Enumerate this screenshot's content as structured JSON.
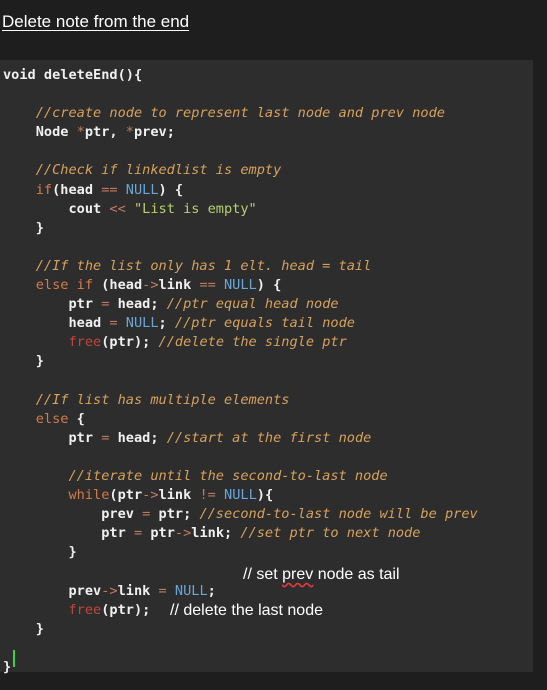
{
  "title": "Delete note from the end",
  "code_lines": [
    [
      {
        "t": "void deleteEnd(){",
        "c": "p"
      }
    ],
    [],
    [
      {
        "t": "    //create node to represent last node and prev node",
        "c": "c"
      }
    ],
    [
      {
        "t": "    Node ",
        "c": "p"
      },
      {
        "t": "*",
        "c": "o"
      },
      {
        "t": "ptr, ",
        "c": "p"
      },
      {
        "t": "*",
        "c": "o"
      },
      {
        "t": "prev;",
        "c": "p"
      }
    ],
    [],
    [
      {
        "t": "    //Check if linkedlist is empty",
        "c": "c"
      }
    ],
    [
      {
        "t": "    if",
        "c": "k"
      },
      {
        "t": "(head ",
        "c": "p"
      },
      {
        "t": "==",
        "c": "o"
      },
      {
        "t": " ",
        "c": "p"
      },
      {
        "t": "NULL",
        "c": "n"
      },
      {
        "t": ") {",
        "c": "p"
      }
    ],
    [
      {
        "t": "        cout ",
        "c": "p"
      },
      {
        "t": "<<",
        "c": "o"
      },
      {
        "t": " ",
        "c": "p"
      },
      {
        "t": "\"List is empty\"",
        "c": "s"
      }
    ],
    [
      {
        "t": "    }",
        "c": "p"
      }
    ],
    [],
    [
      {
        "t": "    //If the list only has 1 elt. head = tail",
        "c": "c"
      }
    ],
    [
      {
        "t": "    else if",
        "c": "k"
      },
      {
        "t": " (head",
        "c": "p"
      },
      {
        "t": "->",
        "c": "o"
      },
      {
        "t": "link ",
        "c": "p"
      },
      {
        "t": "==",
        "c": "o"
      },
      {
        "t": " ",
        "c": "p"
      },
      {
        "t": "NULL",
        "c": "n"
      },
      {
        "t": ") {",
        "c": "p"
      }
    ],
    [
      {
        "t": "        ptr ",
        "c": "p"
      },
      {
        "t": "=",
        "c": "o"
      },
      {
        "t": " head; ",
        "c": "p"
      },
      {
        "t": "//ptr equal head node",
        "c": "c"
      }
    ],
    [
      {
        "t": "        head ",
        "c": "p"
      },
      {
        "t": "=",
        "c": "o"
      },
      {
        "t": " ",
        "c": "p"
      },
      {
        "t": "NULL",
        "c": "n"
      },
      {
        "t": "; ",
        "c": "p"
      },
      {
        "t": "//ptr equals tail node",
        "c": "c"
      }
    ],
    [
      {
        "t": "        ",
        "c": "p"
      },
      {
        "t": "free",
        "c": "f"
      },
      {
        "t": "(ptr); ",
        "c": "p"
      },
      {
        "t": "//delete the single ptr",
        "c": "c"
      }
    ],
    [
      {
        "t": "    }",
        "c": "p"
      }
    ],
    [],
    [
      {
        "t": "    //If list has multiple elements",
        "c": "c"
      }
    ],
    [
      {
        "t": "    else",
        "c": "k"
      },
      {
        "t": " {",
        "c": "p"
      }
    ],
    [
      {
        "t": "        ptr ",
        "c": "p"
      },
      {
        "t": "=",
        "c": "o"
      },
      {
        "t": " head; ",
        "c": "p"
      },
      {
        "t": "//start at the first node",
        "c": "c"
      }
    ],
    [],
    [
      {
        "t": "        //iterate until the second-to-last node",
        "c": "c"
      }
    ],
    [
      {
        "t": "        while",
        "c": "k"
      },
      {
        "t": "(ptr",
        "c": "p"
      },
      {
        "t": "->",
        "c": "o"
      },
      {
        "t": "link ",
        "c": "p"
      },
      {
        "t": "!=",
        "c": "o"
      },
      {
        "t": " ",
        "c": "p"
      },
      {
        "t": "NULL",
        "c": "n"
      },
      {
        "t": "){",
        "c": "p"
      }
    ],
    [
      {
        "t": "            prev ",
        "c": "p"
      },
      {
        "t": "=",
        "c": "o"
      },
      {
        "t": " ptr; ",
        "c": "p"
      },
      {
        "t": "//second-to-last node will be prev",
        "c": "c"
      }
    ],
    [
      {
        "t": "            ptr ",
        "c": "p"
      },
      {
        "t": "=",
        "c": "o"
      },
      {
        "t": " ptr",
        "c": "p"
      },
      {
        "t": "->",
        "c": "o"
      },
      {
        "t": "link; ",
        "c": "p"
      },
      {
        "t": "//set ptr to next node",
        "c": "c"
      }
    ],
    [
      {
        "t": "        }",
        "c": "p"
      }
    ],
    [],
    [
      {
        "t": "        prev",
        "c": "p"
      },
      {
        "t": "->",
        "c": "o"
      },
      {
        "t": "link ",
        "c": "p"
      },
      {
        "t": "=",
        "c": "o"
      },
      {
        "t": " ",
        "c": "p"
      },
      {
        "t": "NULL",
        "c": "n"
      },
      {
        "t": ";",
        "c": "p"
      }
    ],
    [
      {
        "t": "        ",
        "c": "p"
      },
      {
        "t": "free",
        "c": "f"
      },
      {
        "t": "(ptr);",
        "c": "p"
      }
    ],
    [
      {
        "t": "    }",
        "c": "p"
      }
    ],
    [],
    [
      {
        "t": "}",
        "c": "p"
      }
    ]
  ],
  "annotations": {
    "set_prev": {
      "before": "// set ",
      "flagged": "prev",
      "after": " node as tail"
    },
    "delete_last": "// delete the last node"
  },
  "colors": {
    "background": "#1e1e1e",
    "editor": "#2d2d2d",
    "comment": "#d6a15c",
    "keyword": "#d47a4a",
    "null": "#6aa5d8",
    "string": "#b9cf6e",
    "free": "#c2453b",
    "cursor": "#3fd23f"
  }
}
